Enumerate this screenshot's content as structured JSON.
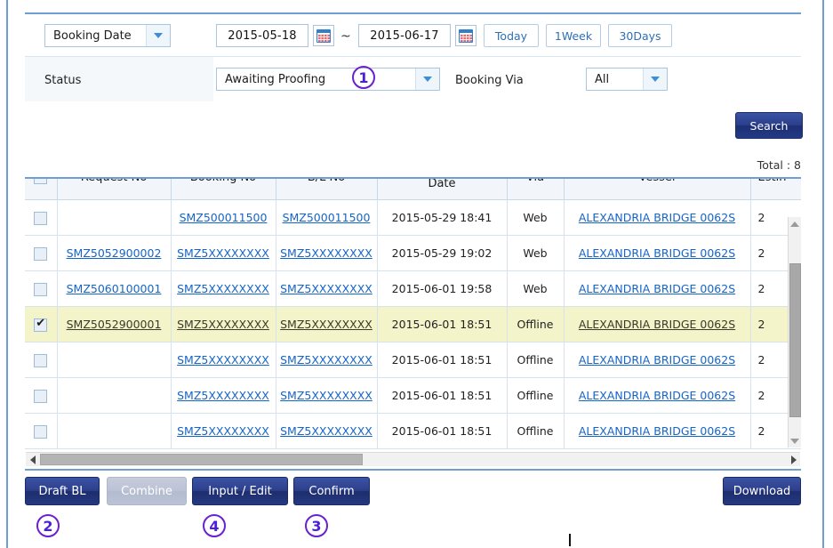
{
  "search_panel": {
    "criteria_select": {
      "value": "Booking Date",
      "icon": "chevron-down-icon"
    },
    "date_from": "2015-05-18",
    "date_to": "2015-06-17",
    "range_separator": "~",
    "calendar_icon": "calendar-icon",
    "quick_ranges": [
      "Today",
      "1Week",
      "30Days"
    ],
    "status_label": "Status",
    "status_select": {
      "value": "Awaiting Proofing",
      "icon": "chevron-down-icon"
    },
    "booking_via_label": "Booking Via",
    "booking_via_select": {
      "value": "All",
      "icon": "chevron-down-icon"
    }
  },
  "search_button": "Search",
  "total_text": "Total : 8",
  "grid": {
    "columns": [
      "",
      "Request No",
      "Booking No",
      "B/L No",
      "Request (Update) Date",
      "Via",
      "Vessel",
      "Estin"
    ],
    "header_checkbox": false,
    "rows": [
      {
        "checked": false,
        "selected": false,
        "request_no": "",
        "booking_no": "SMZ500011500",
        "bl_no": "SMZ500011500",
        "request_date": "2015-05-29 18:41",
        "via": "Web",
        "vessel": "ALEXANDRIA BRIDGE 0062S",
        "estimated": "2"
      },
      {
        "checked": false,
        "selected": false,
        "request_no": "SMZ5052900002",
        "booking_no": "SMZ5XXXXXXXX",
        "bl_no": "SMZ5XXXXXXXX",
        "request_date": "2015-05-29 19:02",
        "via": "Web",
        "vessel": "ALEXANDRIA BRIDGE 0062S",
        "estimated": "2"
      },
      {
        "checked": false,
        "selected": false,
        "request_no": "SMZ5060100001",
        "booking_no": "SMZ5XXXXXXXX",
        "bl_no": "SMZ5XXXXXXXX",
        "request_date": "2015-06-01 19:58",
        "via": "Web",
        "vessel": "ALEXANDRIA BRIDGE 0062S",
        "estimated": "2"
      },
      {
        "checked": true,
        "selected": true,
        "request_no": "SMZ5052900001",
        "booking_no": "SMZ5XXXXXXXX",
        "bl_no": "SMZ5XXXXXXXX",
        "request_date": "2015-06-01 18:51",
        "via": "Offline",
        "vessel": "ALEXANDRIA BRIDGE 0062S",
        "estimated": "2"
      },
      {
        "checked": false,
        "selected": false,
        "request_no": "",
        "booking_no": "SMZ5XXXXXXXX",
        "bl_no": "SMZ5XXXXXXXX",
        "request_date": "2015-06-01 18:51",
        "via": "Offline",
        "vessel": "ALEXANDRIA BRIDGE 0062S",
        "estimated": "2"
      },
      {
        "checked": false,
        "selected": false,
        "request_no": "",
        "booking_no": "SMZ5XXXXXXXX",
        "bl_no": "SMZ5XXXXXXXX",
        "request_date": "2015-06-01 18:51",
        "via": "Offline",
        "vessel": "ALEXANDRIA BRIDGE 0062S",
        "estimated": "2"
      },
      {
        "checked": false,
        "selected": false,
        "request_no": "",
        "booking_no": "SMZ5XXXXXXXX",
        "bl_no": "SMZ5XXXXXXXX",
        "request_date": "2015-06-01 18:51",
        "via": "Offline",
        "vessel": "ALEXANDRIA BRIDGE 0062S",
        "estimated": "2"
      }
    ]
  },
  "actions": {
    "draft_bl": "Draft BL",
    "combine": "Combine",
    "combine_disabled": true,
    "input_edit": "Input / Edit",
    "confirm": "Confirm",
    "download": "Download"
  },
  "annotations": [
    {
      "label": "1"
    },
    {
      "label": "2"
    },
    {
      "label": "4"
    },
    {
      "label": "3"
    }
  ],
  "colors": {
    "accent_blue": "#6f9fd0",
    "button_navy": "#22357d",
    "link_blue": "#1565c8",
    "selected_row": "#f4f4ca",
    "annotation_purple": "#4b1fd8"
  }
}
